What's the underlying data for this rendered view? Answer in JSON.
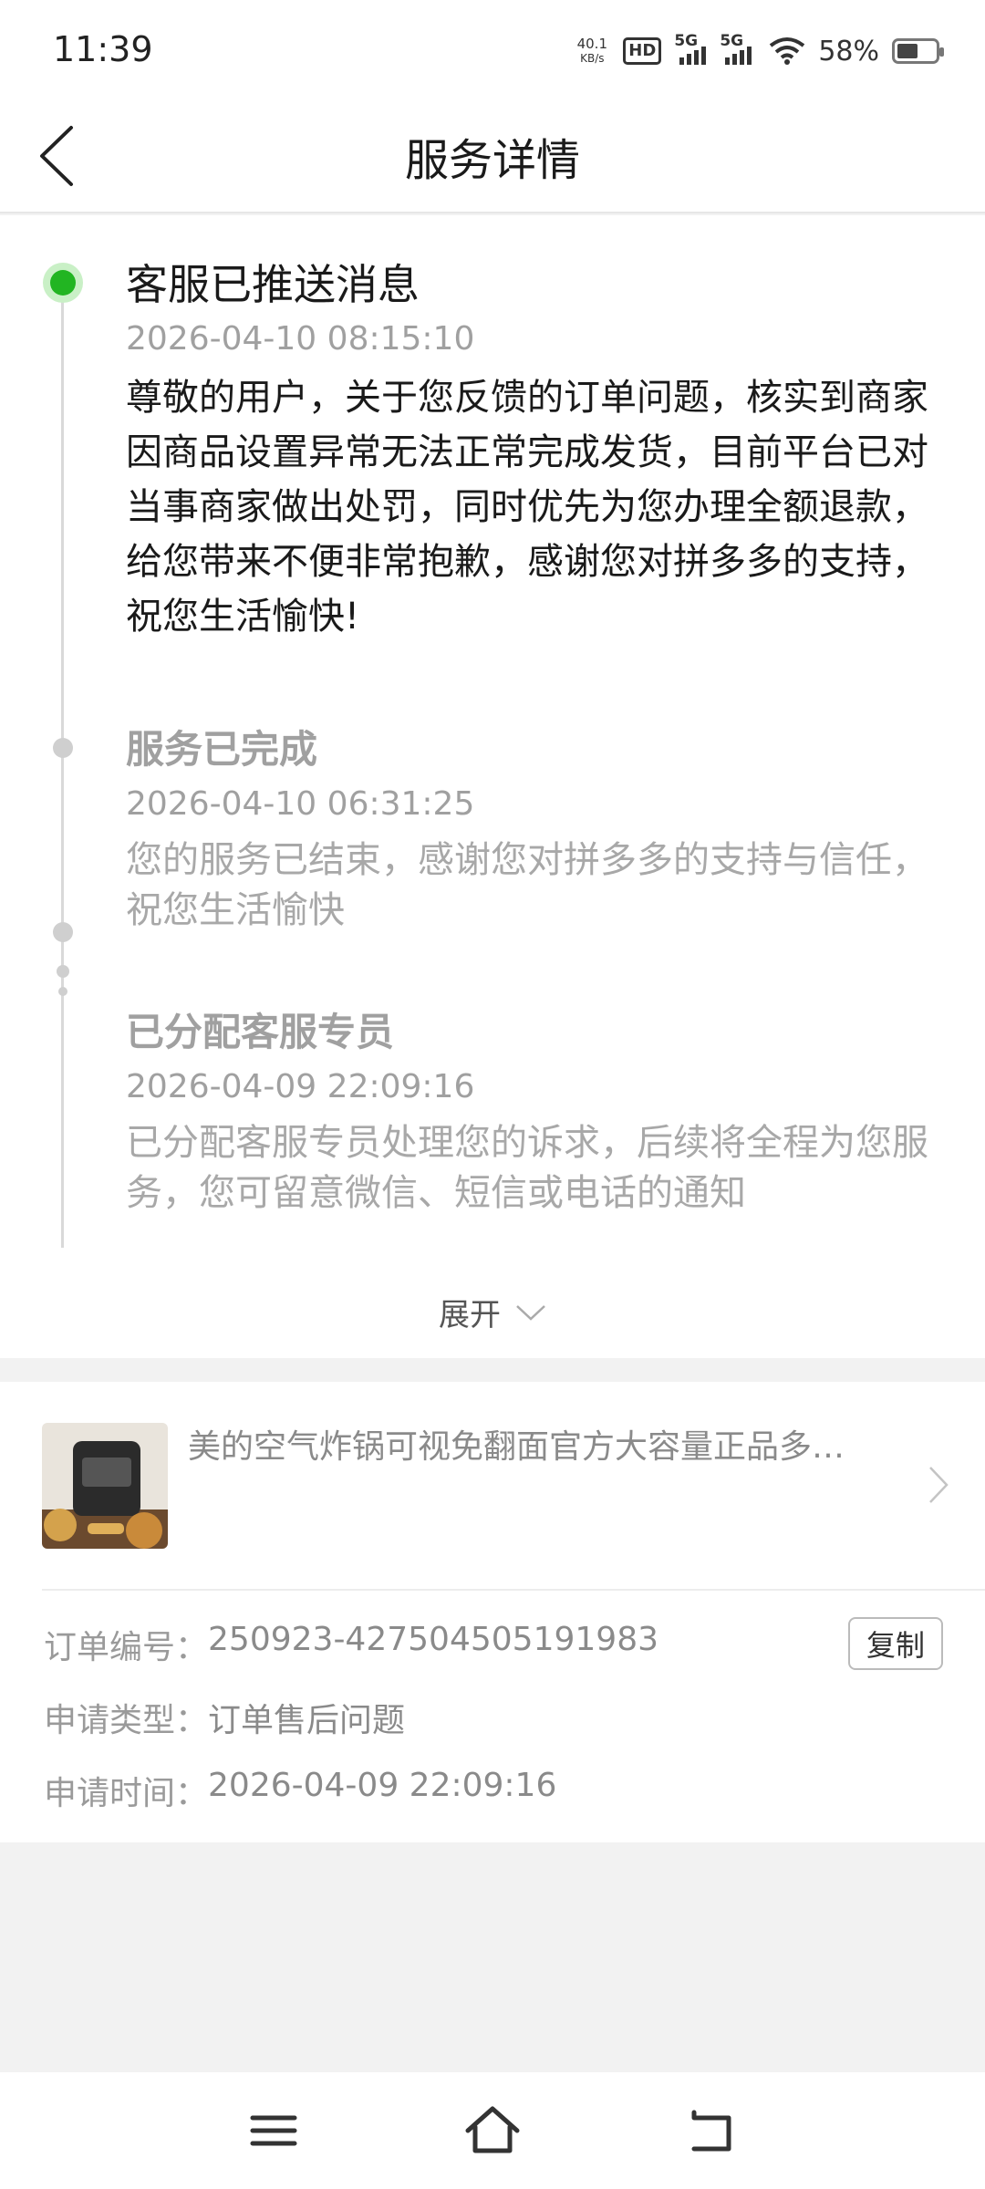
{
  "status_bar": {
    "time": "11:39",
    "net_speed_value": "40.1",
    "net_speed_unit": "KB/s",
    "hd_label": "HD",
    "sim1_label": "5G",
    "sim2_label": "5G",
    "battery_percent": "58%",
    "battery_level": 0.58
  },
  "header": {
    "title": "服务详情"
  },
  "timeline": {
    "events": [
      {
        "title": "客服已推送消息",
        "time": "2026-04-10 08:15:10",
        "body": "尊敬的用户，关于您反馈的订单问题，核实到商家因商品设置异常无法正常完成发货，目前平台已对当事商家做出处罚，同时优先为您办理全额退款，给您带来不便非常抱歉，感谢您对拼多多的支持，祝您生活愉快!"
      },
      {
        "title": "服务已完成",
        "time": "2026-04-10 06:31:25",
        "body": "您的服务已结束，感谢您对拼多多的支持与信任，祝您生活愉快"
      },
      {
        "title": "已分配客服专员",
        "time": "2026-04-09 22:09:16",
        "body": "已分配客服专员处理您的诉求，后续将全程为您服务，您可留意微信、短信或电话的通知"
      }
    ],
    "expand_label": "展开"
  },
  "order": {
    "product_name": "美的空气炸锅可视免翻面官方大容量正品多…",
    "rows": [
      {
        "key": "订单编号：",
        "value": "250923-427504505191983"
      },
      {
        "key": "申请类型：",
        "value": "订单售后问题"
      },
      {
        "key": "申请时间：",
        "value": "2026-04-09 22:09:16"
      }
    ],
    "copy_label": "复制"
  },
  "colors": {
    "accent_green": "#22b522",
    "muted_text": "#a0a0a0",
    "page_bg": "#f2f2f2"
  }
}
